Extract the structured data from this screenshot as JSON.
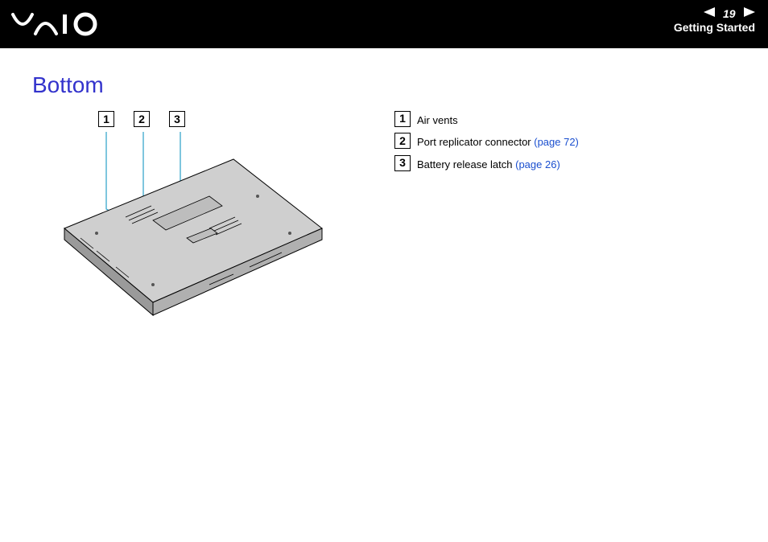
{
  "header": {
    "logo_text": "VAIO",
    "page_number": "19",
    "section": "Getting Started"
  },
  "title": "Bottom",
  "figure": {
    "callouts": [
      "1",
      "2",
      "3"
    ]
  },
  "legend": [
    {
      "num": "1",
      "text": "Air vents",
      "pageref": ""
    },
    {
      "num": "2",
      "text": "Port replicator connector ",
      "pageref": "(page 72)"
    },
    {
      "num": "3",
      "text": "Battery release latch ",
      "pageref": "(page 26)"
    }
  ]
}
